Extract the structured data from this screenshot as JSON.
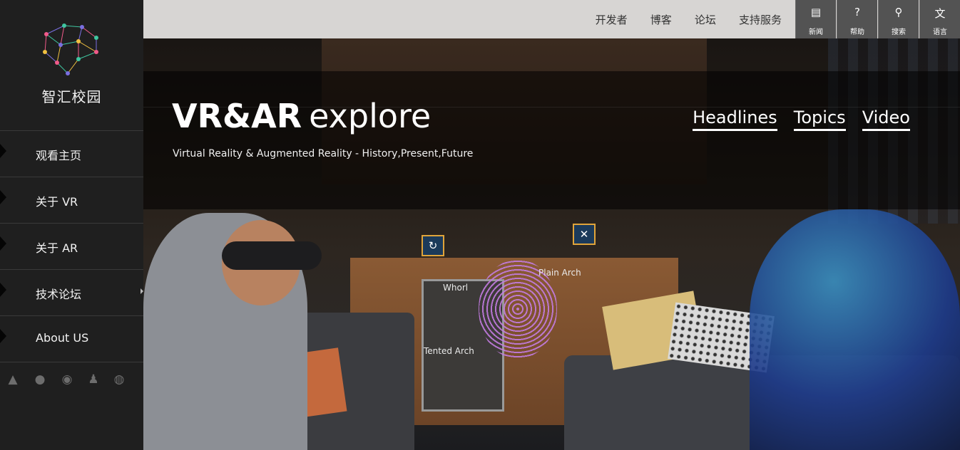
{
  "sidebar": {
    "logo_text": "智汇校园",
    "nav": [
      {
        "label": "观看主页"
      },
      {
        "label": "关于 VR"
      },
      {
        "label": "关于 AR"
      },
      {
        "label": "技术论坛"
      },
      {
        "label": "About US"
      }
    ],
    "social_icons": [
      "android-icon",
      "wechat-icon",
      "weibo-icon",
      "qq-icon",
      "github-icon"
    ]
  },
  "topbar": {
    "links": [
      "开发者",
      "博客",
      "论坛",
      "支持服务"
    ],
    "tiles": [
      {
        "label": "新闻",
        "icon": "news-icon"
      },
      {
        "label": "帮助",
        "icon": "help-icon"
      },
      {
        "label": "搜索",
        "icon": "search-icon"
      },
      {
        "label": "语言",
        "icon": "language-icon"
      }
    ]
  },
  "hero": {
    "title_bold": "VR&AR",
    "title_light": "explore",
    "tagline": "Virtual Reality & Augmented Reality - History,Present,Future",
    "nav": [
      "Headlines",
      "Topics",
      "Video"
    ],
    "scene_labels": {
      "whorl": "Whorl",
      "plain_arch": "Plain Arch",
      "tented_arch": "Tented Arch"
    }
  },
  "colors": {
    "sidebar_bg": "#1f1f1f",
    "topbar_bg": "#d7d5d3",
    "tile_bg": "#535353",
    "accent_orange": "#e0a43a"
  }
}
